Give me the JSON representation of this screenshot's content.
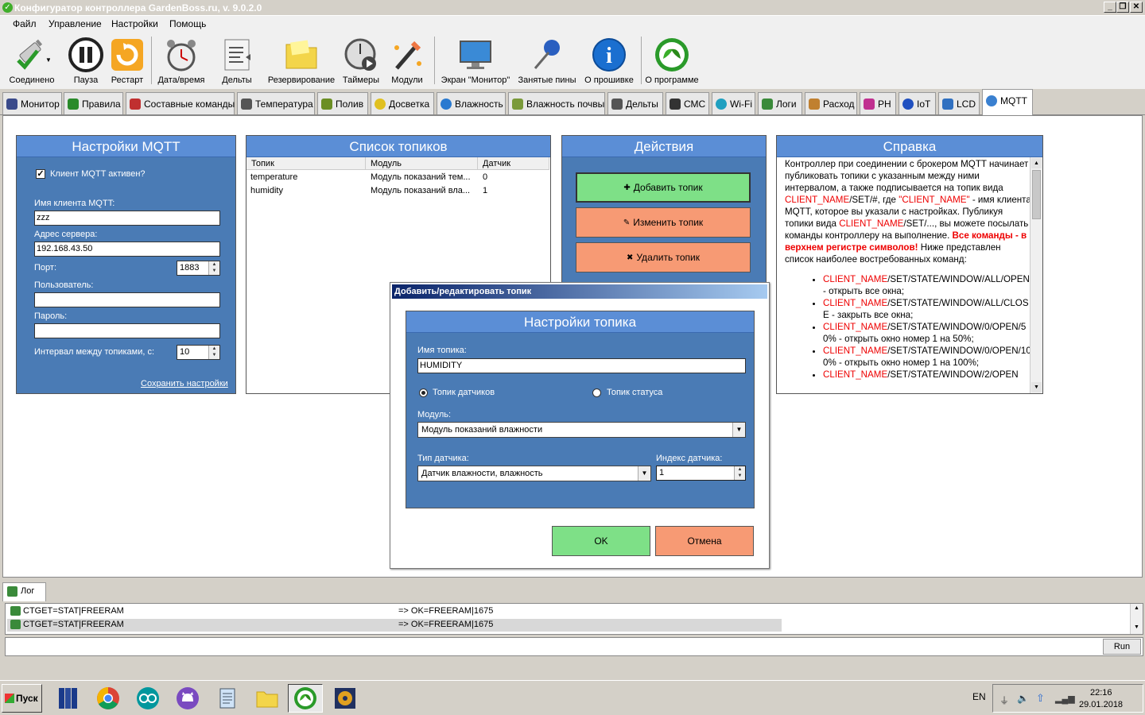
{
  "window": {
    "title": "Конфигуратор контроллера GardenBoss.ru, v. 9.0.2.0",
    "controls": [
      "_",
      "❐",
      "✕"
    ]
  },
  "menu": [
    "Файл",
    "Управление",
    "Настройки",
    "Помощь"
  ],
  "toolbar": [
    {
      "label": "Соединено",
      "icon": "connected-plug-icon"
    },
    {
      "label": "Пауза",
      "icon": "pause-icon"
    },
    {
      "label": "Рестарт",
      "icon": "restart-icon"
    },
    {
      "label": "Дата/время",
      "icon": "alarm-clock-icon"
    },
    {
      "label": "Дельты",
      "icon": "deltas-icon"
    },
    {
      "label": "Резервирование",
      "icon": "backup-folder-icon"
    },
    {
      "label": "Таймеры",
      "icon": "timer-icon"
    },
    {
      "label": "Модули",
      "icon": "magic-wand-icon"
    },
    {
      "label": "Экран \"Монитор\"",
      "icon": "monitor-screen-icon"
    },
    {
      "label": "Занятые пины",
      "icon": "pushpin-icon"
    },
    {
      "label": "О прошивке",
      "icon": "info-icon"
    },
    {
      "label": "О программе",
      "icon": "leaf-logo-icon"
    }
  ],
  "tabs": [
    {
      "label": "Монитор",
      "color": "#3a4a8a"
    },
    {
      "label": "Правила",
      "color": "#2a8a2a"
    },
    {
      "label": "Составные команды",
      "color": "#c03030"
    },
    {
      "label": "Температура",
      "color": "#555555"
    },
    {
      "label": "Полив",
      "color": "#6b8e23"
    },
    {
      "label": "Досветка",
      "color": "#e0c020"
    },
    {
      "label": "Влажность",
      "color": "#2a7ad0"
    },
    {
      "label": "Влажность почвы",
      "color": "#7a9a3a"
    },
    {
      "label": "Дельты",
      "color": "#555555"
    },
    {
      "label": "СМС",
      "color": "#333333"
    },
    {
      "label": "Wi-Fi",
      "color": "#20a0c0"
    },
    {
      "label": "Логи",
      "color": "#3a8a3a"
    },
    {
      "label": "Расход",
      "color": "#c08030"
    },
    {
      "label": "PH",
      "color": "#c03090"
    },
    {
      "label": "IoT",
      "color": "#2050c0"
    },
    {
      "label": "LCD",
      "color": "#3070c0"
    },
    {
      "label": "MQTT",
      "color": "#3a80d0"
    }
  ],
  "active_tab": "MQTT",
  "mqtt_settings": {
    "header": "Настройки MQTT",
    "client_active_label": "Клиент MQTT активен?",
    "client_active_checked": true,
    "client_name_label": "Имя клиента MQTT:",
    "client_name_value": "zzz",
    "server_label": "Адрес сервера:",
    "server_value": "192.168.43.50",
    "port_label": "Порт:",
    "port_value": "1883",
    "user_label": "Пользователь:",
    "user_value": "",
    "password_label": "Пароль:",
    "password_value": "",
    "interval_label": "Интервал между топиками, с:",
    "interval_value": "10",
    "save_link": "Сохранить настройки"
  },
  "topics": {
    "header": "Список топиков",
    "columns": [
      "Топик",
      "Модуль",
      "Датчик"
    ],
    "rows": [
      {
        "topic": "temperature",
        "module": "Модуль показаний тем...",
        "sensor": "0"
      },
      {
        "topic": "humidity",
        "module": "Модуль показаний вла...",
        "sensor": "1"
      }
    ]
  },
  "actions": {
    "header": "Действия",
    "add": "Добавить топик",
    "edit": "Изменить топик",
    "delete": "Удалить топик"
  },
  "help": {
    "header": "Справка",
    "intro_1": "Контроллер при соединении с брокером MQTT начинает публиковать топики с указанным между ними интервалом, а также подписывается на топик вида ",
    "client_name": "CLIENT_NAME",
    "intro_2": "/SET/#, где ",
    "client_name_quoted": "\"CLIENT_NAME\"",
    "intro_3": " - имя клиента MQTT, которое вы указали с настройках. Публикуя топики вида ",
    "intro_4": "/SET/..., вы можете посылать команды контроллеру на выполнение. ",
    "bold_red": "Все команды - в верхнем регистре символов!",
    "intro_5": " Ниже представлен список наиболее востребованных команд:",
    "items": [
      {
        "path": "/SET/STATE/WINDOW/ALL/OPEN",
        "desc": " - открыть все окна;"
      },
      {
        "path": "/SET/STATE/WINDOW/ALL/CLOSE",
        "desc": " - закрыть все окна;"
      },
      {
        "path": "/SET/STATE/WINDOW/0/OPEN/50%",
        "desc": " - открыть окно номер 1 на 50%;"
      },
      {
        "path": "/SET/STATE/WINDOW/0/OPEN/100%",
        "desc": " - открыть окно номер 1 на 100%;"
      },
      {
        "path": "/SET/STATE/WINDOW/2/OPEN",
        "desc": ""
      }
    ]
  },
  "dialog": {
    "title": "Добавить/редактировать топик",
    "header": "Настройки топика",
    "name_label": "Имя топика:",
    "name_value": "HUMIDITY",
    "radio_sensor": "Топик датчиков",
    "radio_status": "Топик статуса",
    "selected_radio": "sensor",
    "module_label": "Модуль:",
    "module_value": "Модуль показаний влажности",
    "sensor_type_label": "Тип датчика:",
    "sensor_type_value": "Датчик влажности, влажность",
    "sensor_index_label": "Индекс датчика:",
    "sensor_index_value": "1",
    "ok": "OK",
    "cancel": "Отмена"
  },
  "log": {
    "tab": "Лог",
    "entries": [
      {
        "cmd": "CTGET=STAT|FREERAM",
        "resp": "=> OK=FREERAM|1675"
      },
      {
        "cmd": "CTGET=STAT|FREERAM",
        "resp": "=> OK=FREERAM|1675"
      }
    ],
    "run": "Run"
  },
  "taskbar": {
    "start": "Пуск",
    "lang": "EN",
    "time": "22:16",
    "date": "29.01.2018",
    "apps": [
      "books-icon",
      "chrome-icon",
      "arduino-icon",
      "github-cat-icon",
      "notepad-icon",
      "folder-icon",
      "gardenboss-leaf-icon",
      "audio-player-icon"
    ]
  },
  "colors": {
    "panel_blue": "#4a7bb5",
    "header_blue": "#5b8ed6",
    "green_button": "#7ee087",
    "orange_button": "#f79a74",
    "help_red": "#e00000"
  }
}
